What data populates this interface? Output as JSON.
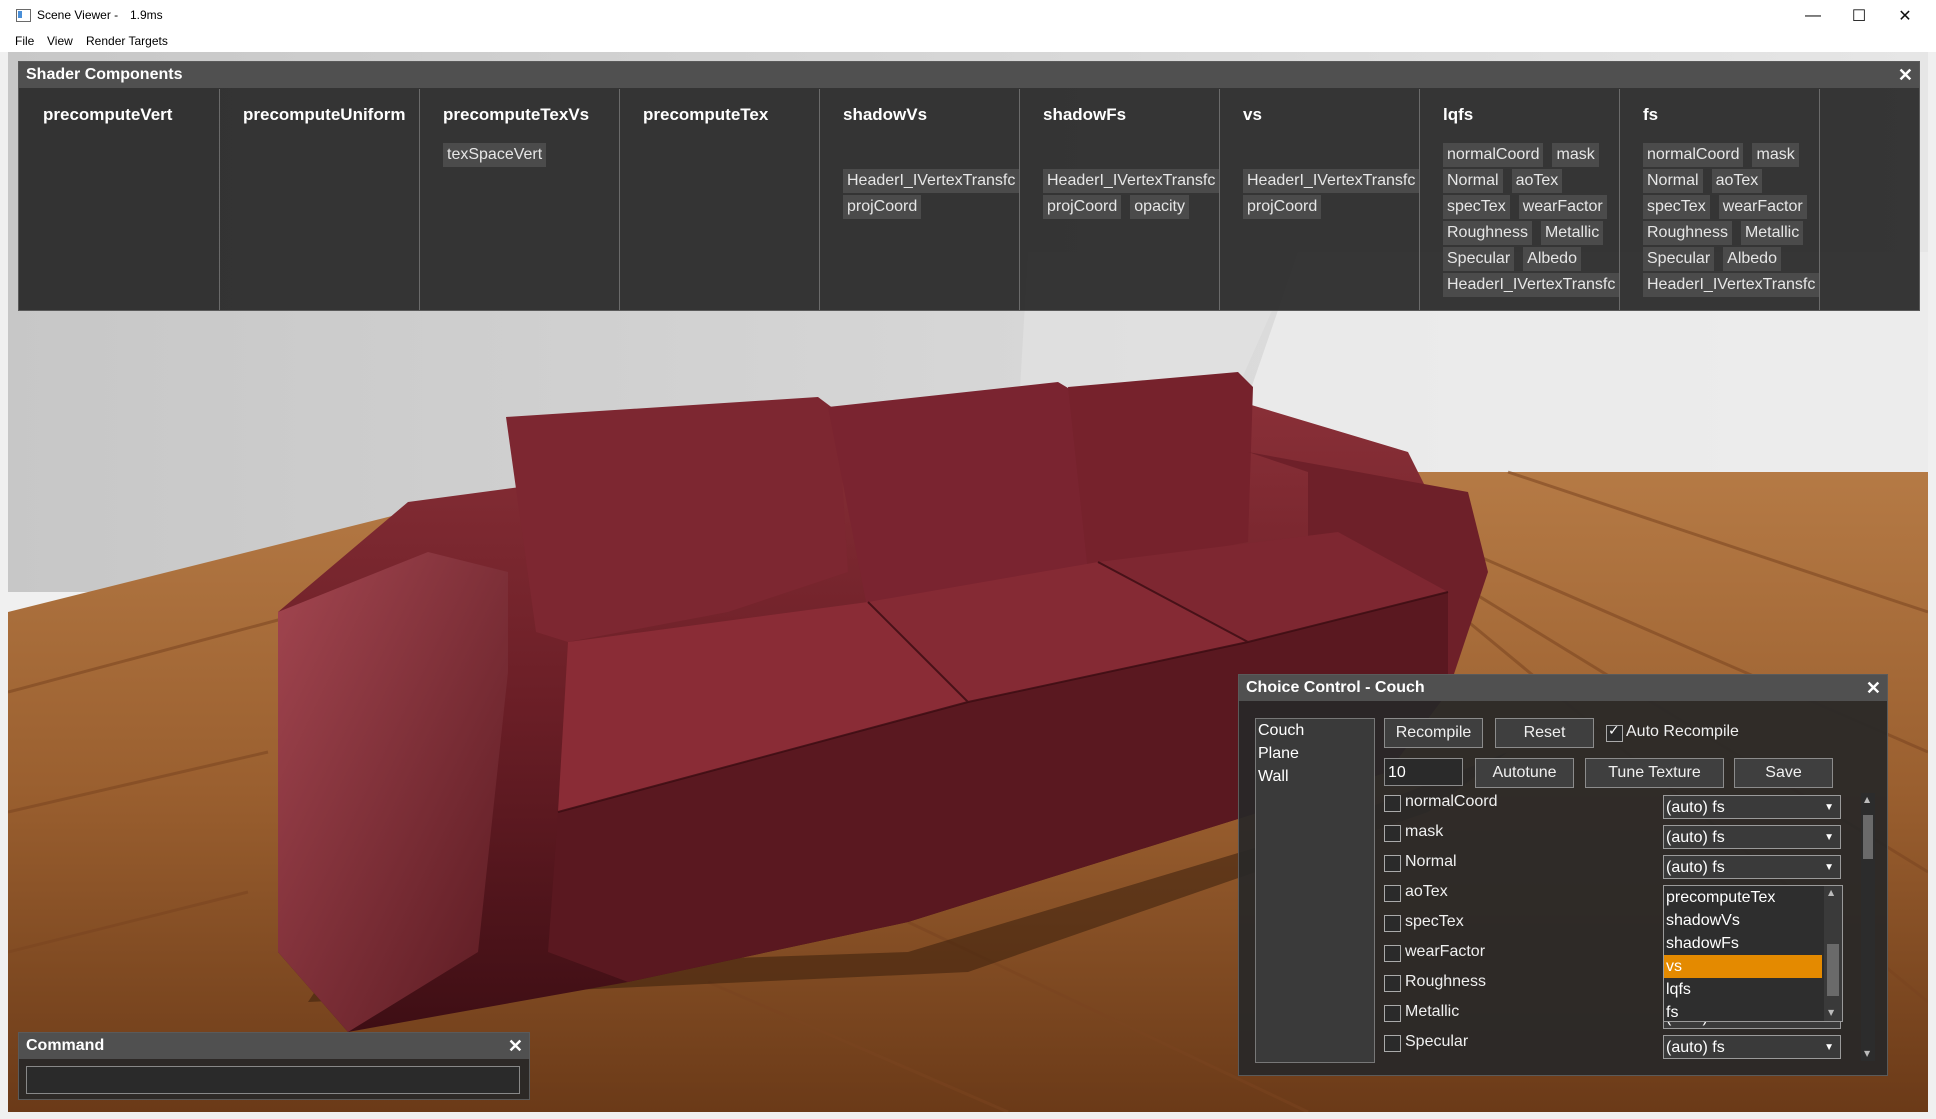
{
  "window": {
    "title": "Scene Viewer -",
    "frame_time": "1.9ms",
    "menu": [
      "File",
      "View",
      "Render Targets"
    ]
  },
  "shader_components": {
    "title": "Shader Components",
    "close": "✕",
    "columns": [
      {
        "name": "precomputeVert",
        "rows": []
      },
      {
        "name": "precomputeUniform",
        "rows": []
      },
      {
        "name": "precomputeTexVs",
        "rows": [
          [
            "texSpaceVert"
          ]
        ]
      },
      {
        "name": "precomputeTex",
        "rows": []
      },
      {
        "name": "shadowVs",
        "rows": [
          [],
          [
            "HeaderI_IVertexTransfc"
          ],
          [
            "projCoord"
          ]
        ]
      },
      {
        "name": "shadowFs",
        "rows": [
          [],
          [
            "HeaderI_IVertexTransfc"
          ],
          [
            "projCoord",
            "opacity"
          ]
        ]
      },
      {
        "name": "vs",
        "rows": [
          [],
          [
            "HeaderI_IVertexTransfc"
          ],
          [
            "projCoord"
          ]
        ]
      },
      {
        "name": "lqfs",
        "rows": [
          [
            "normalCoord",
            "mask"
          ],
          [
            "Normal",
            "aoTex"
          ],
          [
            "specTex",
            "wearFactor"
          ],
          [
            "Roughness",
            "Metallic"
          ],
          [
            "Specular",
            "Albedo"
          ],
          [
            "HeaderI_IVertexTransfc"
          ]
        ]
      },
      {
        "name": "fs",
        "rows": [
          [
            "normalCoord",
            "mask"
          ],
          [
            "Normal",
            "aoTex"
          ],
          [
            "specTex",
            "wearFactor"
          ],
          [
            "Roughness",
            "Metallic"
          ],
          [
            "Specular",
            "Albedo"
          ],
          [
            "HeaderI_IVertexTransfc"
          ]
        ]
      }
    ]
  },
  "command": {
    "title": "Command",
    "close": "✕",
    "value": ""
  },
  "choice_control": {
    "title": "Choice Control - Couch",
    "close": "✕",
    "objects": [
      "Couch",
      "Plane",
      "Wall"
    ],
    "buttons": {
      "recompile": "Recompile",
      "reset": "Reset",
      "autotune": "Autotune",
      "tune_texture": "Tune Texture",
      "save": "Save"
    },
    "auto_recompile": {
      "label": "Auto Recompile",
      "checked": true
    },
    "tune_value": "10",
    "components": [
      {
        "name": "normalCoord",
        "choice": "(auto) fs"
      },
      {
        "name": "mask",
        "choice": "(auto) fs"
      },
      {
        "name": "Normal",
        "choice": "(auto) fs"
      },
      {
        "name": "aoTex",
        "choice": ""
      },
      {
        "name": "specTex",
        "choice": ""
      },
      {
        "name": "wearFactor",
        "choice": ""
      },
      {
        "name": "Roughness",
        "choice": ""
      },
      {
        "name": "Metallic",
        "choice": "(auto) fs"
      },
      {
        "name": "Specular",
        "choice": "(auto) fs"
      }
    ],
    "dropdown_options": [
      "precomputeTex",
      "shadowVs",
      "shadowFs",
      "vs",
      "lqfs",
      "fs"
    ],
    "dropdown_selected": "vs",
    "dropdown_color": "#e48a00"
  }
}
